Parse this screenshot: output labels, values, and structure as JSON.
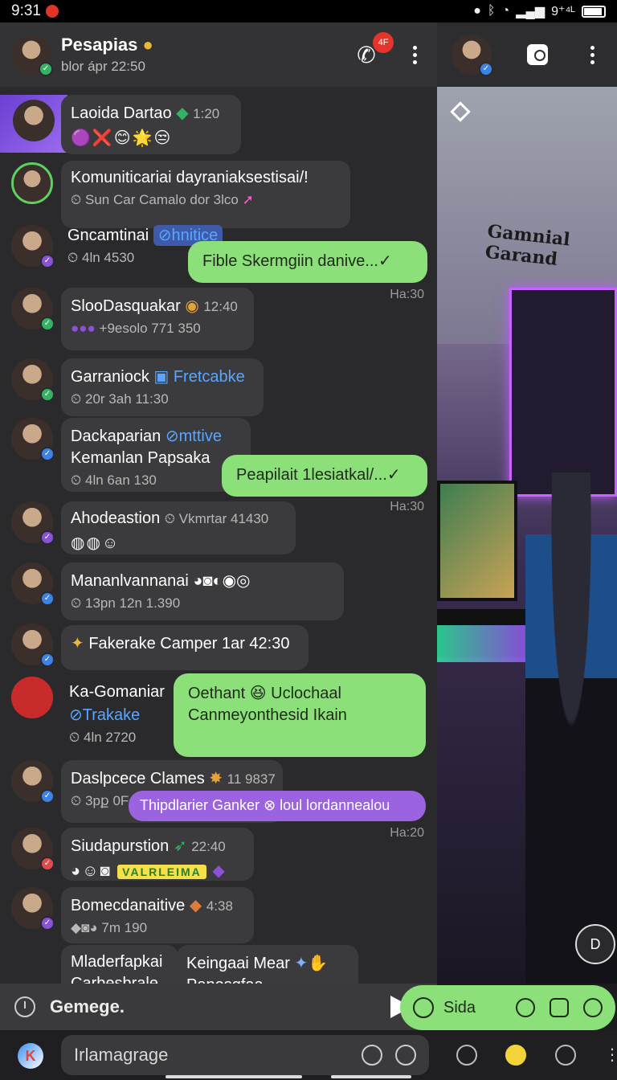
{
  "status_bar": {
    "time": "9:31",
    "right_text": "9⁺⁴ᴸ"
  },
  "chat": {
    "title": "Pesapias",
    "subtitle": "blor ápr 22:50",
    "call_badge": "4F"
  },
  "messages": [
    {
      "name": "Laoida Dartao",
      "time": "1:20",
      "emojis": "🟣❌😊🌟😒"
    },
    {
      "name": "Komuniticariai dayraniaksestisai/!",
      "meta": "Sun Car Camalo dor 3lco"
    },
    {
      "name": "Gncamtinai",
      "tag": "hnitice",
      "meta": "4ln 4530"
    },
    {
      "name": "SlooDasquakar",
      "time": "12:40",
      "meta": "+9esolo 771 350"
    },
    {
      "name": "Garraniock",
      "tag": "Fretcabke",
      "meta": "20r 3ah 11:30"
    },
    {
      "name": "Dackaparian",
      "tag": "mttive",
      "line2": "Kemanlan Papsaka",
      "meta": "4ln 6an 130"
    },
    {
      "name": "Ahodeastion",
      "extra": "Vkmrtar 41430"
    },
    {
      "name": "Mananlvannanai",
      "meta": "13pn 12n 1.390"
    },
    {
      "name": "Fakerake Camper 1ar 42:30"
    },
    {
      "name": "Ka-Gomaniar",
      "tag": "Trakake",
      "meta": "4ln 2720"
    },
    {
      "name": "Daslpcece Clames",
      "time": "11 9837",
      "meta": "3pք 0F"
    },
    {
      "name": "Siudapurstion",
      "time": "22:40",
      "sticker": "VALRLEIMA"
    },
    {
      "name": "Bomecdanaitive",
      "time": "4:38",
      "meta": "7m 190"
    },
    {
      "name": "Mladerfapkai",
      "line2": "Carbesbrale"
    }
  ],
  "outgoing": [
    {
      "text": "Fible Skermgiin danive...✓",
      "time": "Ha:30"
    },
    {
      "text": "Peapilait  1lesiatkal/...✓",
      "time": "Ha:30"
    },
    {
      "text": "Oethant 😆 Uclochaal Canmeyonthesid Ikain"
    },
    {
      "text": "Thipdlarier Ganker ⊗ loul lordannealou",
      "time": "Ha:20"
    },
    {
      "text": "Keingaai Mear",
      "line2": "Panesgfaa"
    }
  ],
  "composer": {
    "text": "Gemege."
  },
  "green_action": {
    "label": "Sida"
  },
  "input": {
    "placeholder": "Irlamagrage"
  },
  "right_panel": {
    "sign_text": "Gamnial Garand",
    "round_button": "D"
  }
}
